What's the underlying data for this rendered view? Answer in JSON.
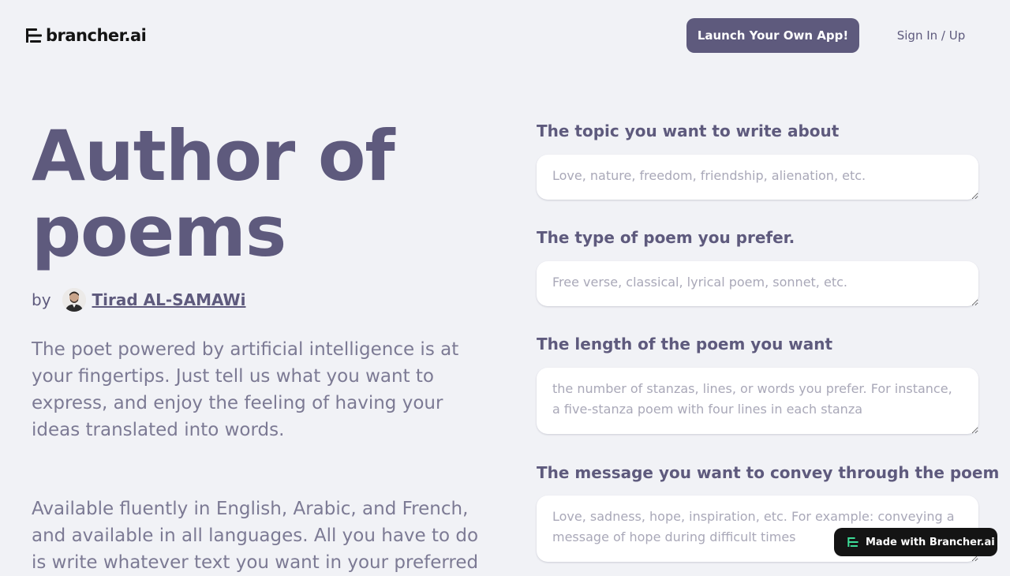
{
  "header": {
    "logo_text": "brancher.ai",
    "launch_label": "Launch Your Own App!",
    "signin_label": "Sign In / Up"
  },
  "hero": {
    "title_line1": "Author of",
    "title_line2": "poems",
    "by_label": "by",
    "author_name": "Tirad AL-SAMAWi",
    "description": "The poet powered by artificial intelligence is at your fingertips. Just tell us what you want to express, and enjoy the feeling of having your ideas translated into words.",
    "description2": "Available fluently in English, Arabic, and French, and available in all languages. All you have to do is write whatever text you want in your preferred"
  },
  "form": {
    "fields": [
      {
        "label": "The topic you want to write about",
        "placeholder": "Love, nature, freedom, friendship, alienation, etc.",
        "value": ""
      },
      {
        "label": "The type of poem you prefer.",
        "placeholder": "Free verse, classical, lyrical poem, sonnet, etc.",
        "value": ""
      },
      {
        "label": "The length of the poem you want",
        "placeholder": "the number of stanzas, lines, or words you prefer. For instance, a five-stanza poem with four lines in each stanza",
        "value": ""
      },
      {
        "label": "The message you want to convey through the poem",
        "placeholder": "Love, sadness, hope, inspiration, etc. For example: conveying a message of hope during difficult times",
        "value": ""
      }
    ]
  },
  "badge": {
    "label": "Made with Brancher.ai"
  },
  "colors": {
    "accent": "#5e5a7d",
    "background": "#f1f2f6",
    "badge_bg": "#141414",
    "badge_icon": "#3ddc97"
  },
  "icons": {
    "logo": "brancher-logo-icon",
    "badge": "brancher-logo-icon",
    "avatar": "author-avatar"
  }
}
